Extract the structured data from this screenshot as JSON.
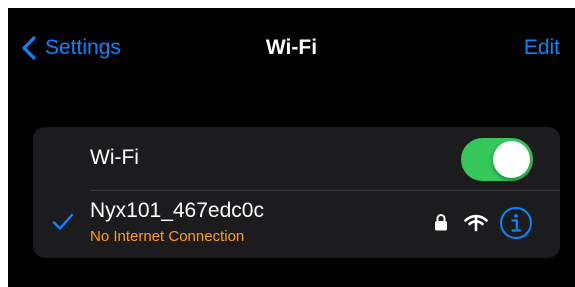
{
  "navbar": {
    "back_label": "Settings",
    "title": "Wi-Fi",
    "edit_label": "Edit"
  },
  "wifi_toggle": {
    "label": "Wi-Fi",
    "state": "on"
  },
  "current_network": {
    "name": "Nyx101_467edc0c",
    "status": "No Internet Connection",
    "connected": true,
    "secured": true
  },
  "icons": {
    "back": "chevron-left-icon",
    "check": "checkmark-icon",
    "lock": "lock-icon",
    "signal": "wifi-signal-icon",
    "info": "info-icon"
  },
  "colors": {
    "background": "#000000",
    "card": "#1c1c1e",
    "accent": "#0a84ff",
    "toggle_on": "#34c759",
    "warning": "#ff9f0a",
    "text": "#ffffff"
  }
}
